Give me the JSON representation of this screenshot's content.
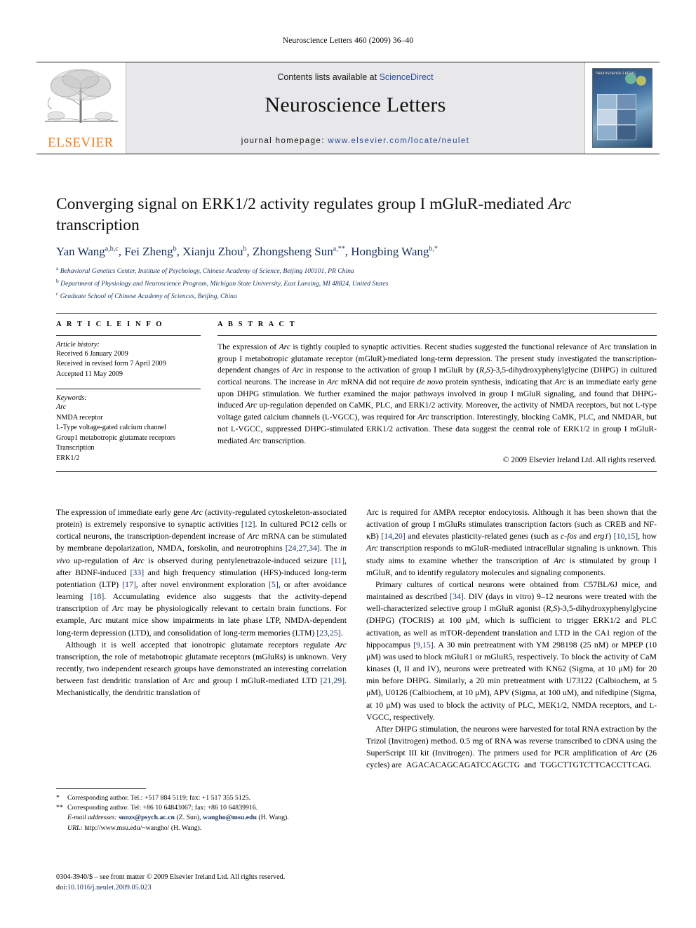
{
  "running_head": "Neuroscience Letters 460 (2009) 36–40",
  "masthead": {
    "publisher_name": "ELSEVIER",
    "contents_prefix": "Contents lists available at ",
    "contents_link": "ScienceDirect",
    "journal_name": "Neuroscience Letters",
    "homepage_prefix": "journal homepage:",
    "homepage_url": "www.elsevier.com/locate/neulet",
    "cover_title": "Neuroscience Letters"
  },
  "article": {
    "title": "Converging signal on ERK1/2 activity regulates group I mGluR-mediated Arc transcription",
    "title_italic_tail": "Arc",
    "authors": "Yan Wang a,b,c, Fei Zheng b, Xianju Zhou b, Zhongsheng Sun a,**, Hongbing Wang b,*",
    "affiliations": [
      "a Behavioral Genetics Center, Institute of Psychology, Chinese Academy of Science, Beijing 100101, PR China",
      "b Department of Physiology and Neuroscience Program, Michigan State University, East Lansing, MI 48824, United States",
      "c Graduate School of Chinese Academy of Sciences, Beijing, China"
    ]
  },
  "article_info": {
    "heading": "A R T I C L E    I N F O",
    "history_label": "Article history:",
    "history": [
      "Received 6 January 2009",
      "Received in revised form 7 April 2009",
      "Accepted 11 May 2009"
    ],
    "keywords_label": "Keywords:",
    "keywords": [
      "Arc",
      "NMDA receptor",
      "L-Type voltage-gated calcium channel",
      "Group1 metabotropic glutamate receptors",
      "Transcription",
      "ERK1/2"
    ]
  },
  "abstract": {
    "heading": "A B S T R A C T",
    "text": "The expression of Arc is tightly coupled to synaptic activities. Recent studies suggested the functional relevance of Arc translation in group I metabotropic glutamate receptor (mGluR)-mediated long-term depression. The present study investigated the transcription-dependent changes of Arc in response to the activation of group I mGluR by (R,S)-3,5-dihydroxyphenylglycine (DHPG) in cultured cortical neurons. The increase in Arc mRNA did not require de novo protein synthesis, indicating that Arc is an immediate early gene upon DHPG stimulation. We further examined the major pathways involved in group I mGluR signaling, and found that DHPG-induced Arc up-regulation depended on CaMK, PLC, and ERK1/2 activity. Moreover, the activity of NMDA receptors, but not L-type voltage gated calcium channels (L-VGCC), was required for Arc transcription. Interestingly, blocking CaMK, PLC, and NMDAR, but not L-VGCC, suppressed DHPG-stimulated ERK1/2 activation. These data suggest the central role of ERK1/2 in group I mGluR-mediated Arc transcription.",
    "copyright": "© 2009 Elsevier Ireland Ltd. All rights reserved."
  },
  "body": {
    "left_paragraphs": [
      "The expression of immediate early gene Arc (activity-regulated cytoskeleton-associated protein) is extremely responsive to synaptic activities [12]. In cultured PC12 cells or cortical neurons, the transcription-dependent increase of Arc mRNA can be stimulated by membrane depolarization, NMDA, forskolin, and neurotrophins [24,27,34]. The in vivo up-regulation of Arc is observed during pentylenetrazole-induced seizure [11], after BDNF-induced [33] and high frequency stimulation (HFS)-induced long-term potentiation (LTP) [17], after novel environment exploration [5], or after avoidance learning [18]. Accumulating evidence also suggests that the activity-depend transcription of Arc may be physiologically relevant to certain brain functions. For example, Arc mutant mice show impairments in late phase LTP, NMDA-dependent long-term depression (LTD), and consolidation of long-term memories (LTM) [23,25].",
      "Although it is well accepted that ionotropic glutamate receptors regulate Arc transcription, the role of metabotropic glutamate receptors (mGluRs) is unknown. Very recently, two independent research groups have demonstrated an interesting correlation between fast dendritic translation of Arc and group I mGluR-mediated LTD [21,29]. Mechanistically, the dendritic translation of"
    ],
    "right_paragraphs": [
      "Arc is required for AMPA receptor endocytosis. Although it has been shown that the activation of group I mGluRs stimulates transcription factors (such as CREB and NF-κB) [14,20] and elevates plasticity-related genes (such as c-fos and erg1) [10,15], how Arc transcription responds to mGluR-mediated intracellular signaling is unknown. This study aims to examine whether the transcription of Arc is stimulated by group I mGluR, and to identify regulatory molecules and signaling components.",
      "Primary cultures of cortical neurons were obtained from C57BL/6J mice, and maintained as described [34]. DIV (days in vitro) 9–12 neurons were treated with the well-characterized selective group I mGluR agonist (R,S)-3,5-dihydroxyphenylglycine (DHPG) (TOCRIS) at 100 μM, which is sufficient to trigger ERK1/2 and PLC activation, as well as mTOR-dependent translation and LTD in the CA1 region of the hippocampus [9,15]. A 30 min pretreatment with YM 298198 (25 nM) or MPEP (10 μM) was used to block mGluR1 or mGluR5, respectively. To block the activity of CaM kinases (I, II and IV), neurons were pretreated with KN62 (Sigma, at 10 μM) for 20 min before DHPG. Similarly, a 20 min pretreatment with U73122 (Calbiochem, at 5 μM), U0126 (Calbiochem, at 10 μM), APV (Sigma, at 100 uM), and nifedipine (Sigma, at 10 μM) was used to block the activity of PLC, MEK1/2, NMDA receptors, and L-VGCC, respectively.",
      "After DHPG stimulation, the neurons were harvested for total RNA extraction by the Trizol (Invitrogen) method. 0.5 mg of RNA was reverse transcribed to cDNA using the SuperScript III kit (Invitrogen). The primers used for PCR amplification of Arc (26 cycles) are AGACACAGCAGATCCAGCTG and TGGCTTGTCTTCACCTTCAG."
    ]
  },
  "footnotes": {
    "note1_mark": "*",
    "note1": "Corresponding author. Tel.: +517 884 5119; fax: +1 517 355 5125.",
    "note2_mark": "**",
    "note2": "Corresponding author. Tel: +86 10 64843067; fax: +86 10 64839916.",
    "email_label": "E-mail addresses:",
    "email1": "sunzs@psych.ac.cn",
    "email1_owner": "(Z. Sun),",
    "email2": "wangho@msu.edu",
    "email2_owner": "(H. Wang).",
    "url_label": "URL:",
    "url_value": "http://www.msu.edu/~wangho/ (H. Wang).",
    "issn_line": "0304-3940/$ – see front matter © 2009 Elsevier Ireland Ltd. All rights reserved.",
    "doi_prefix": "doi:",
    "doi_value": "10.1016/j.neulet.2009.05.023"
  }
}
